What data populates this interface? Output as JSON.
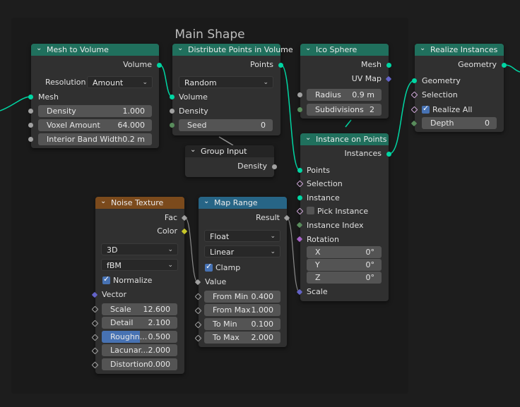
{
  "frame": {
    "title": "Main Shape"
  },
  "colors": {
    "geometry_header": "#20705d",
    "texture_header": "#7b4a1c",
    "converter_header": "#276586",
    "input_header": "#242424",
    "wire_geometry": "#00d6a3",
    "wire_float": "#a1a1a1"
  },
  "mesh_to_volume": {
    "title": "Mesh to Volume",
    "out_volume": "Volume",
    "resolution_label": "Resolution",
    "resolution_value": "Amount",
    "in_mesh": "Mesh",
    "density_label": "Density",
    "density_value": "1.000",
    "voxel_label": "Voxel Amount",
    "voxel_value": "64.000",
    "band_label": "Interior Band Width",
    "band_value": "0.2 m"
  },
  "distribute": {
    "title": "Distribute Points in Volume",
    "out_points": "Points",
    "mode_value": "Random",
    "in_volume": "Volume",
    "in_density": "Density",
    "seed_label": "Seed",
    "seed_value": "0"
  },
  "group_input": {
    "title": "Group Input",
    "out_density": "Density"
  },
  "ico_sphere": {
    "title": "Ico Sphere",
    "out_mesh": "Mesh",
    "out_uv": "UV Map",
    "radius_label": "Radius",
    "radius_value": "0.9 m",
    "subdiv_label": "Subdivisions",
    "subdiv_value": "2"
  },
  "instance_on_points": {
    "title": "Instance on Points",
    "out_instances": "Instances",
    "in_points": "Points",
    "in_selection": "Selection",
    "in_instance": "Instance",
    "pick_label": "Pick Instance",
    "in_index": "Instance Index",
    "in_rotation": "Rotation",
    "x_label": "X",
    "x_value": "0°",
    "y_label": "Y",
    "y_value": "0°",
    "z_label": "Z",
    "z_value": "0°",
    "in_scale": "Scale"
  },
  "realize": {
    "title": "Realize Instances",
    "out_geometry": "Geometry",
    "in_geometry": "Geometry",
    "in_selection": "Selection",
    "realize_all": "Realize All",
    "depth_label": "Depth",
    "depth_value": "0"
  },
  "noise": {
    "title": "Noise Texture",
    "out_fac": "Fac",
    "out_color": "Color",
    "dim_value": "3D",
    "type_value": "fBM",
    "normalize_label": "Normalize",
    "in_vector": "Vector",
    "scale_label": "Scale",
    "scale_value": "12.600",
    "detail_label": "Detail",
    "detail_value": "2.100",
    "rough_label": "Roughn...",
    "rough_value": "0.500",
    "rough_fraction": 0.5,
    "lacun_label": "Lacunar...",
    "lacun_value": "2.000",
    "distortion_label": "Distortion",
    "distortion_value": "0.000"
  },
  "map_range": {
    "title": "Map Range",
    "out_result": "Result",
    "type_value": "Float",
    "interp_value": "Linear",
    "clamp_label": "Clamp",
    "in_value": "Value",
    "from_min_label": "From Min",
    "from_min_value": "0.400",
    "from_max_label": "From Max",
    "from_max_value": "1.000",
    "to_min_label": "To Min",
    "to_min_value": "0.100",
    "to_max_label": "To Max",
    "to_max_value": "2.000"
  }
}
